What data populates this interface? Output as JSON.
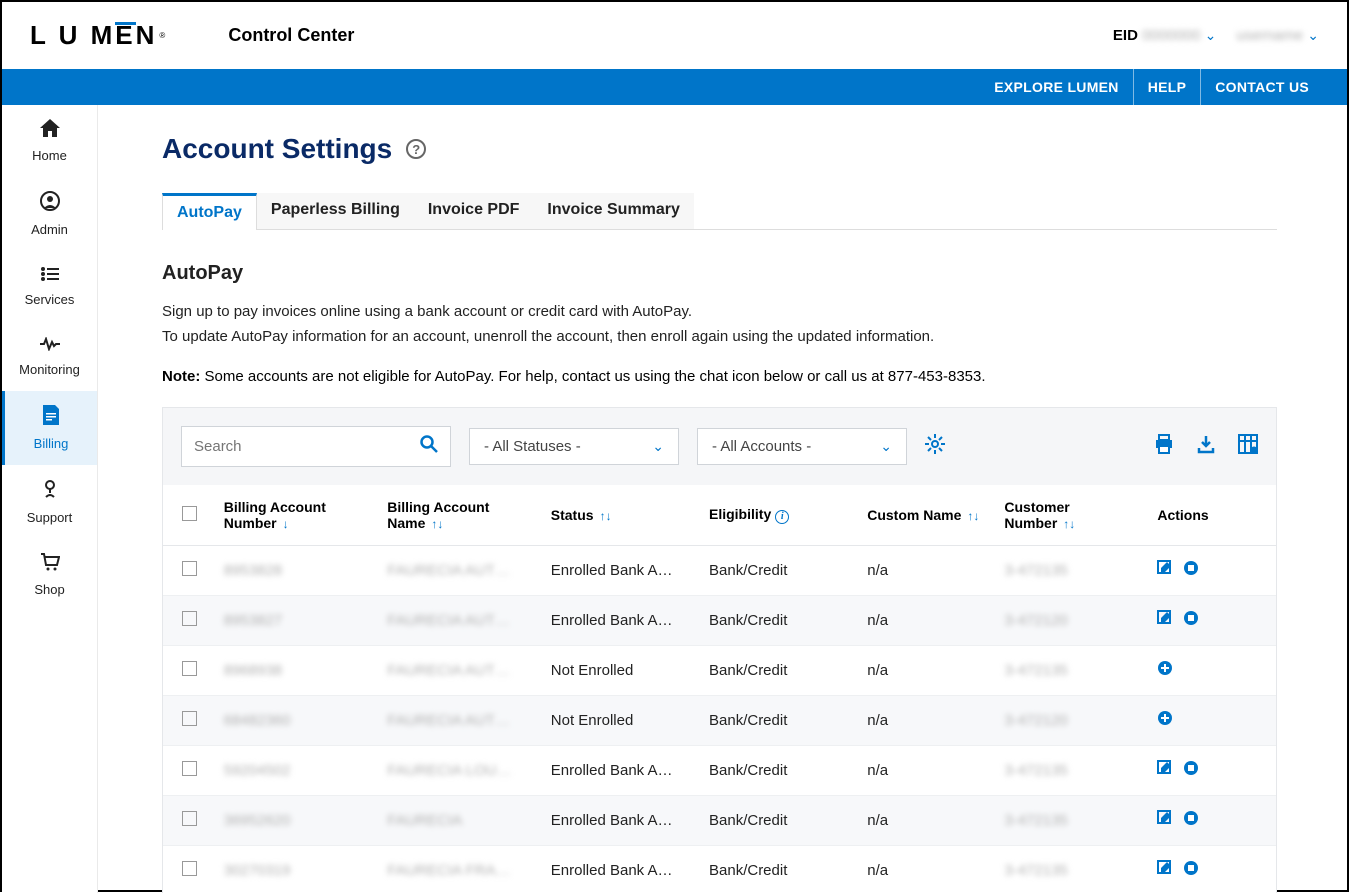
{
  "header": {
    "logo_text": "LUM  N",
    "logo_e": "E",
    "app_name": "Control Center",
    "eid_label": "EID",
    "eid_value": "0000000",
    "user_name": "username"
  },
  "nav": {
    "explore": "EXPLORE LUMEN",
    "help": "HELP",
    "contact": "CONTACT US"
  },
  "sidebar": [
    {
      "label": "Home",
      "icon": "⌂"
    },
    {
      "label": "Admin",
      "icon": "◯"
    },
    {
      "label": "Services",
      "icon": "≣"
    },
    {
      "label": "Monitoring",
      "icon": "∿"
    },
    {
      "label": "Billing",
      "icon": "▦"
    },
    {
      "label": "Support",
      "icon": "⚙"
    },
    {
      "label": "Shop",
      "icon": "🛒"
    }
  ],
  "page": {
    "title": "Account Settings",
    "tabs": [
      "AutoPay",
      "Paperless Billing",
      "Invoice PDF",
      "Invoice Summary"
    ],
    "section_title": "AutoPay",
    "desc_line1": "Sign up to pay invoices online using a bank account or credit card with AutoPay.",
    "desc_line2": "To update AutoPay information for an account, unenroll the account, then enroll again using the updated information.",
    "note_label": "Note:",
    "note_text": " Some accounts are not eligible for AutoPay. For help, contact us using the chat icon below or call us at 877-453-8353."
  },
  "controls": {
    "search_placeholder": "Search",
    "status_filter": "- All Statuses -",
    "account_filter": "- All Accounts -"
  },
  "columns": {
    "ban": "Billing Account Number",
    "bnm": "Billing Account Name",
    "status": "Status",
    "elig": "Eligibility",
    "custom": "Custom Name",
    "cnum": "Customer Number",
    "actions": "Actions"
  },
  "rows": [
    {
      "ban": "8953828",
      "bnm": "FAURECIA AUT…",
      "status": "Enrolled Bank A…",
      "elig": "Bank/Credit",
      "custom": "n/a",
      "cnum": "3-472135",
      "enrolled": true
    },
    {
      "ban": "8953827",
      "bnm": "FAURECIA AUT…",
      "status": "Enrolled Bank A…",
      "elig": "Bank/Credit",
      "custom": "n/a",
      "cnum": "3-472120",
      "enrolled": true
    },
    {
      "ban": "8968938",
      "bnm": "FAURECIA AUT…",
      "status": "Not Enrolled",
      "elig": "Bank/Credit",
      "custom": "n/a",
      "cnum": "3-472135",
      "enrolled": false
    },
    {
      "ban": "68482360",
      "bnm": "FAURECIA AUT…",
      "status": "Not Enrolled",
      "elig": "Bank/Credit",
      "custom": "n/a",
      "cnum": "3-472120",
      "enrolled": false
    },
    {
      "ban": "59204502",
      "bnm": "FAURECIA LOU…",
      "status": "Enrolled Bank A…",
      "elig": "Bank/Credit",
      "custom": "n/a",
      "cnum": "3-472135",
      "enrolled": true
    },
    {
      "ban": "36952620",
      "bnm": "FAURECIA",
      "status": "Enrolled Bank A…",
      "elig": "Bank/Credit",
      "custom": "n/a",
      "cnum": "3-472135",
      "enrolled": true
    },
    {
      "ban": "30270319",
      "bnm": "FAURECIA FRA…",
      "status": "Enrolled Bank A…",
      "elig": "Bank/Credit",
      "custom": "n/a",
      "cnum": "3-472135",
      "enrolled": true
    }
  ]
}
